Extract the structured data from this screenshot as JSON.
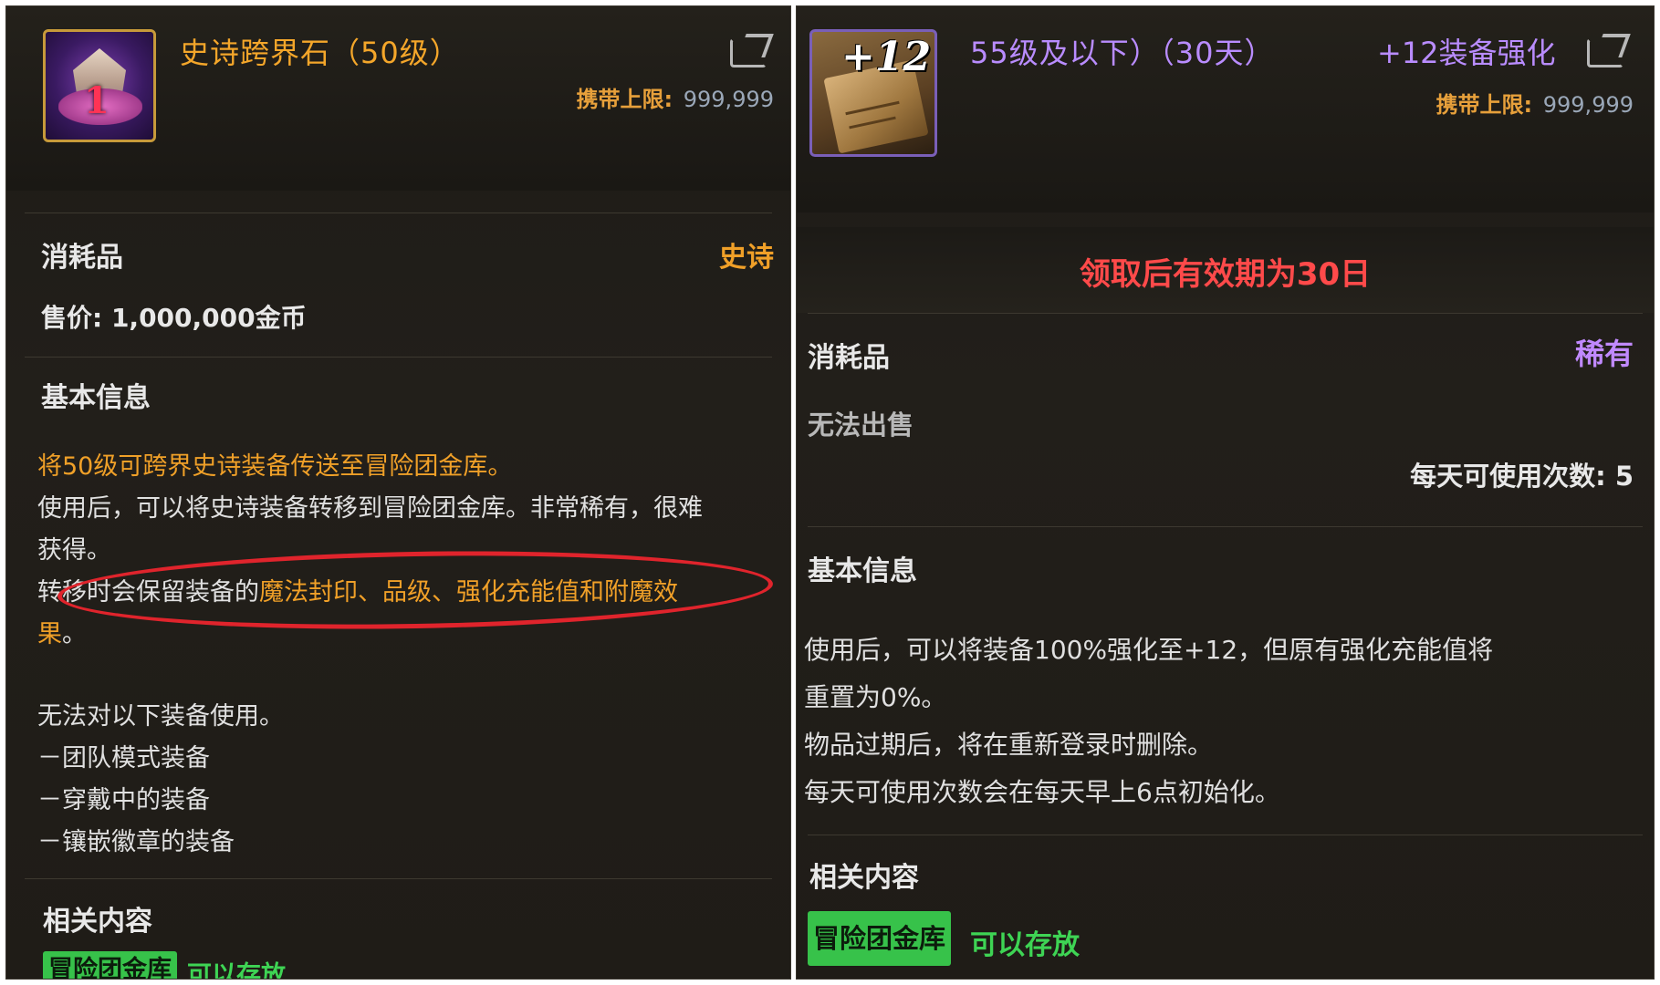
{
  "left": {
    "title": "史诗跨界石（50级）",
    "limit_label": "携带上限:",
    "limit_value": "999,999",
    "type_label": "消耗品",
    "rarity": "史诗",
    "price": "售价: 1,000,000金币",
    "section_basic": "基本信息",
    "highlight": "将50级可跨界史诗装备传送至冒险团金库。",
    "desc_line1": "使用后，可以将史诗装备转移到冒险团金库。非常稀有，很难",
    "desc_line2": "获得。",
    "desc_line3_prefix": "转移时会保留装备的",
    "desc_line3_gold": "魔法封印、品级、强化充能值和附魔效",
    "desc_line4_gold": "果",
    "desc_line4_suffix": "。",
    "restrict_title": "无法对以下装备使用。",
    "restrict_1": "－团队模式装备",
    "restrict_2": "－穿戴中的装备",
    "restrict_3": "－镶嵌徽章的装备",
    "section_related": "相关内容",
    "badge": "冒险团金库",
    "badge_status": "可以存放"
  },
  "right": {
    "title": "55级及以下）（30天）",
    "subtitle": "+12装备强化",
    "icon_label": "+12",
    "limit_label": "携带上限:",
    "limit_value": "999,999",
    "expiry": "领取后有效期为30日",
    "type_label": "消耗品",
    "rarity": "稀有",
    "no_sell": "无法出售",
    "daily_uses": "每天可使用次数: 5",
    "section_basic": "基本信息",
    "desc_line1": "使用后，可以将装备100%强化至+12，但原有强化充能值将",
    "desc_line2": "重置为0%。",
    "desc_line3": "物品过期后，将在重新登录时删除。",
    "desc_line4": "每天可使用次数会在每天早上6点初始化。",
    "section_related": "相关内容",
    "badge": "冒险团金库",
    "badge_status": "可以存放"
  },
  "colors": {
    "epic": "#f4a62a",
    "rare": "#b98cff",
    "warning": "#ff4a4a",
    "green": "#37c24a",
    "annotation": "#e0242c"
  },
  "icons": [
    "share-icon",
    "epic-stone-icon",
    "enhance-scroll-icon"
  ]
}
